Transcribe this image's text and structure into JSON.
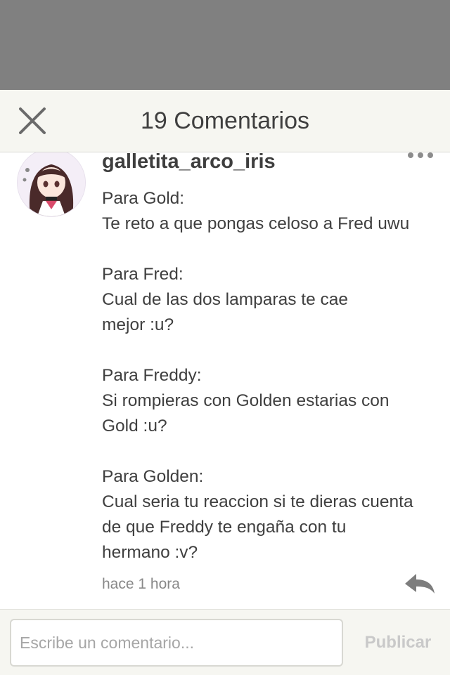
{
  "header": {
    "title": "19 Comentarios",
    "close_icon": "close-icon"
  },
  "comment": {
    "author": "galletita_arco_iris",
    "lines": [
      "Para Gold:",
      "Te reto a que pongas celoso a Fred uwu",
      "",
      "Para Fred:",
      "Cual de las dos lamparas te cae",
      "mejor :u?",
      "",
      "Para Freddy:",
      "Si rompieras con Golden estarias con",
      "Gold :u?",
      "",
      "Para Golden:",
      "Cual seria tu reaccion si te dieras cuenta",
      "de que Freddy te engaña con tu",
      "hermano :v?"
    ],
    "timestamp": "hace 1 hora",
    "more_icon": "more-dots-icon",
    "reply_icon": "reply-arrow-icon"
  },
  "composer": {
    "placeholder": "Escribe un comentario...",
    "value": "",
    "publish_label": "Publicar"
  },
  "colors": {
    "overlay": "#808080",
    "header_bg": "#f6f6f1",
    "text": "#3f3f3f",
    "muted": "#888888",
    "disabled": "#c9c9c9"
  }
}
